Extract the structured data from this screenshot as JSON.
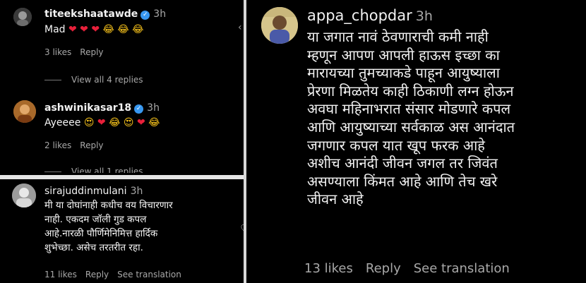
{
  "comments": [
    {
      "username": "titeekshaatawde",
      "verified": true,
      "time": "3h",
      "text": "Mad ❤ ❤ ❤ 😂 😂 😂",
      "likes": "3 likes",
      "reply": "Reply",
      "view_replies": "View all 4 replies"
    },
    {
      "username": "ashwinikasar18",
      "verified": true,
      "time": "3h",
      "text": "Ayeeee 😍 ❤ 😂 😍 ❤ 😂",
      "likes": "2 likes",
      "reply": "Reply",
      "view_replies": "View all 1 replies"
    },
    {
      "username": "sirajuddinmulani",
      "verified": false,
      "time": "3h",
      "lines": [
        "मी या दोघांनाही कधीच वय विचारणार",
        "नाही. एकदम जॉली गुड कपल",
        "आहे.नारळी पौर्णिमेनिमित्त हार्दिक",
        "शुभेच्छा. असेच तरतरीत रहा."
      ],
      "likes": "11 likes",
      "reply": "Reply",
      "see_translation": "See translation"
    }
  ],
  "big_comment": {
    "username": "appa_chopdar",
    "time": "3h",
    "lines": [
      "या जगात नावं ठेवणाराची कमी नाही",
      "म्हणून आपण आपली हाऊस इच्छा का",
      "मारायच्या तुमच्याकडे पाहून आयुष्याला",
      "प्रेरणा मिळतेय काही ठिकाणी लग्न होऊन",
      "अवघा महिनाभरात संसार मोडणारे कपल",
      "आणि आयुष्याच्या सर्वकाळ अस आनंदात",
      "जगणार कपल यात खूप फरक आहे",
      "अशीच आनंदी जीवन जगल तर जिवंत",
      "असण्याला किंमत आहे आणि तेच खरे",
      "जीवन आहे"
    ],
    "likes": "13 likes",
    "reply": "Reply",
    "see_translation": "See translation"
  },
  "icons": {
    "verified": "verified-badge-icon",
    "heart_outline": "heart-outline-icon",
    "chevron": "chevron-left-icon"
  },
  "colors": {
    "background": "#000000",
    "verified_blue": "#3797f0",
    "meta_gray": "#a8a8a8"
  }
}
